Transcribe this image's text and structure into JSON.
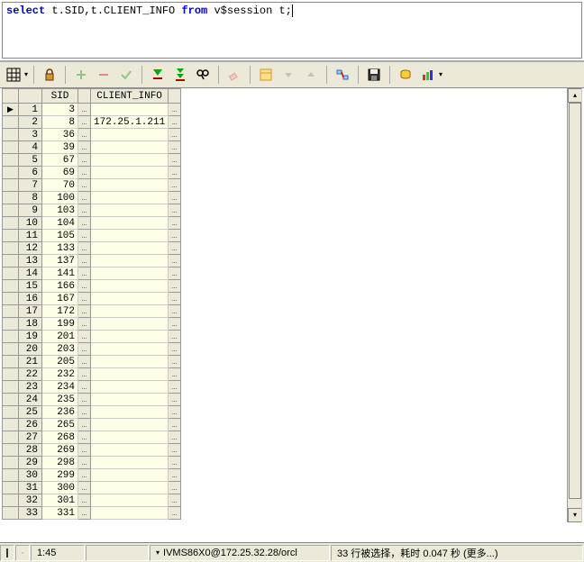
{
  "sql": {
    "kw1": "select",
    "part1": " t.SID,t.CLIENT_INFO ",
    "kw2": "from",
    "part2": " v$session t;"
  },
  "columns": {
    "c1": "SID",
    "c2": "CLIENT_INFO"
  },
  "rows": [
    {
      "n": "1",
      "sid": "3",
      "info": ""
    },
    {
      "n": "2",
      "sid": "8",
      "info": "172.25.1.211"
    },
    {
      "n": "3",
      "sid": "36",
      "info": ""
    },
    {
      "n": "4",
      "sid": "39",
      "info": ""
    },
    {
      "n": "5",
      "sid": "67",
      "info": ""
    },
    {
      "n": "6",
      "sid": "69",
      "info": ""
    },
    {
      "n": "7",
      "sid": "70",
      "info": ""
    },
    {
      "n": "8",
      "sid": "100",
      "info": ""
    },
    {
      "n": "9",
      "sid": "103",
      "info": ""
    },
    {
      "n": "10",
      "sid": "104",
      "info": ""
    },
    {
      "n": "11",
      "sid": "105",
      "info": ""
    },
    {
      "n": "12",
      "sid": "133",
      "info": ""
    },
    {
      "n": "13",
      "sid": "137",
      "info": ""
    },
    {
      "n": "14",
      "sid": "141",
      "info": ""
    },
    {
      "n": "15",
      "sid": "166",
      "info": ""
    },
    {
      "n": "16",
      "sid": "167",
      "info": ""
    },
    {
      "n": "17",
      "sid": "172",
      "info": ""
    },
    {
      "n": "18",
      "sid": "199",
      "info": ""
    },
    {
      "n": "19",
      "sid": "201",
      "info": ""
    },
    {
      "n": "20",
      "sid": "203",
      "info": ""
    },
    {
      "n": "21",
      "sid": "205",
      "info": ""
    },
    {
      "n": "22",
      "sid": "232",
      "info": ""
    },
    {
      "n": "23",
      "sid": "234",
      "info": ""
    },
    {
      "n": "24",
      "sid": "235",
      "info": ""
    },
    {
      "n": "25",
      "sid": "236",
      "info": ""
    },
    {
      "n": "26",
      "sid": "265",
      "info": ""
    },
    {
      "n": "27",
      "sid": "268",
      "info": ""
    },
    {
      "n": "28",
      "sid": "269",
      "info": ""
    },
    {
      "n": "29",
      "sid": "298",
      "info": ""
    },
    {
      "n": "30",
      "sid": "299",
      "info": ""
    },
    {
      "n": "31",
      "sid": "300",
      "info": ""
    },
    {
      "n": "32",
      "sid": "301",
      "info": ""
    },
    {
      "n": "33",
      "sid": "331",
      "info": ""
    }
  ],
  "status": {
    "pos": "1:45",
    "conn": "IVMS86X0@172.25.32.28/orcl",
    "msg": "33 行被选择，耗时 0.047 秒 (更多...)"
  },
  "ellipsis": "…"
}
